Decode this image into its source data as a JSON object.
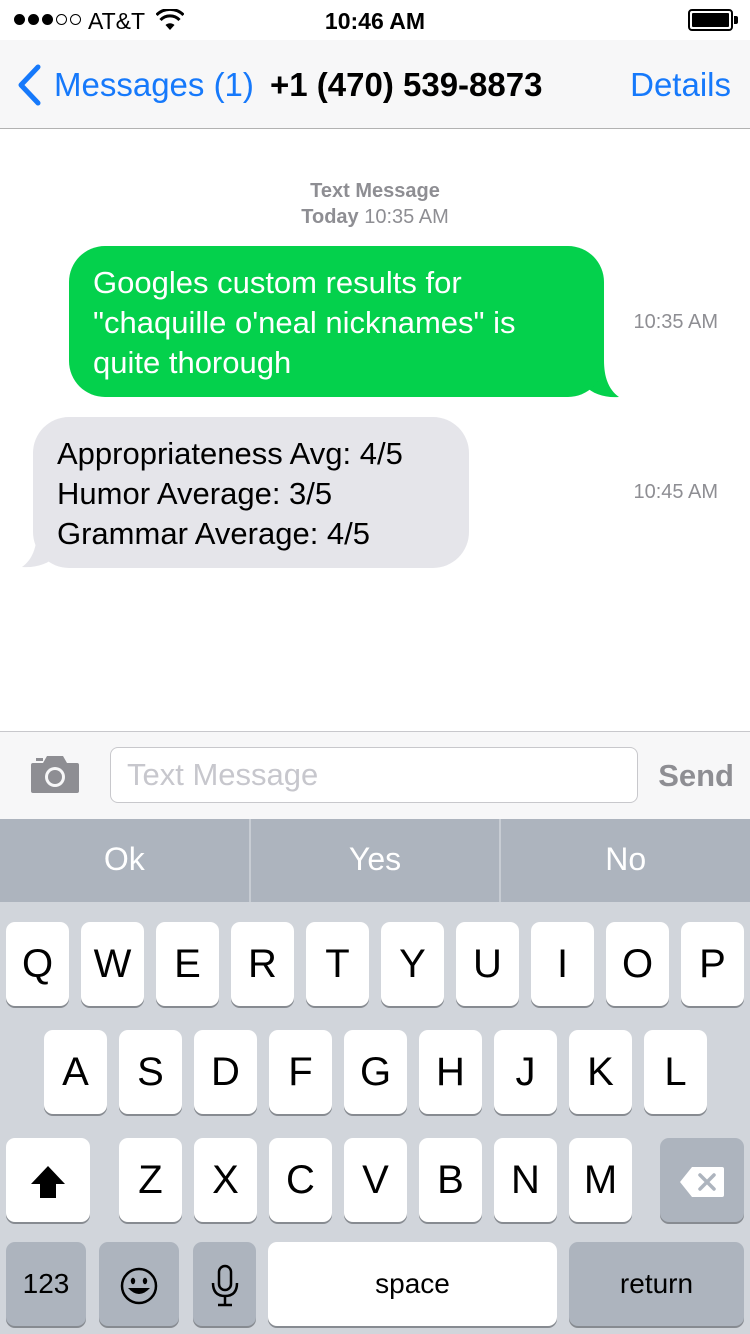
{
  "status_bar": {
    "signal_dots": [
      true,
      true,
      true,
      false,
      false
    ],
    "carrier": "AT&T",
    "time": "10:46 AM"
  },
  "nav": {
    "back_label": "Messages (1)",
    "title": "+1 (470) 539-8873",
    "details_label": "Details",
    "accent_color": "#1679fb"
  },
  "conversation": {
    "header_type": "Text Message",
    "header_day": "Today",
    "header_time": "10:35 AM",
    "messages": [
      {
        "direction": "sent",
        "text": "Googles custom results for \"chaquille o'neal nicknames\" is quite thorough",
        "time": "10:35 AM",
        "color": "#04d14c"
      },
      {
        "direction": "received",
        "text": "Appropriateness Avg: 4/5 Humor Average: 3/5 Grammar Average: 4/5",
        "lines": [
          "Appropriateness Avg: 4/5",
          "Humor Average: 3/5",
          "Grammar Average: 4/5"
        ],
        "time": "10:45 AM",
        "color": "#e5e5ea"
      }
    ]
  },
  "input": {
    "placeholder": "Text Message",
    "value": "",
    "send_label": "Send"
  },
  "quick_replies": [
    "Ok",
    "Yes",
    "No"
  ],
  "keyboard": {
    "row1": [
      "Q",
      "W",
      "E",
      "R",
      "T",
      "Y",
      "U",
      "I",
      "O",
      "P"
    ],
    "row2": [
      "A",
      "S",
      "D",
      "F",
      "G",
      "H",
      "J",
      "K",
      "L"
    ],
    "row3": [
      "Z",
      "X",
      "C",
      "V",
      "B",
      "N",
      "M"
    ],
    "numbers_label": "123",
    "space_label": "space",
    "return_label": "return",
    "icons": [
      "shift-icon",
      "backspace-icon",
      "emoji-icon",
      "microphone-icon"
    ]
  }
}
